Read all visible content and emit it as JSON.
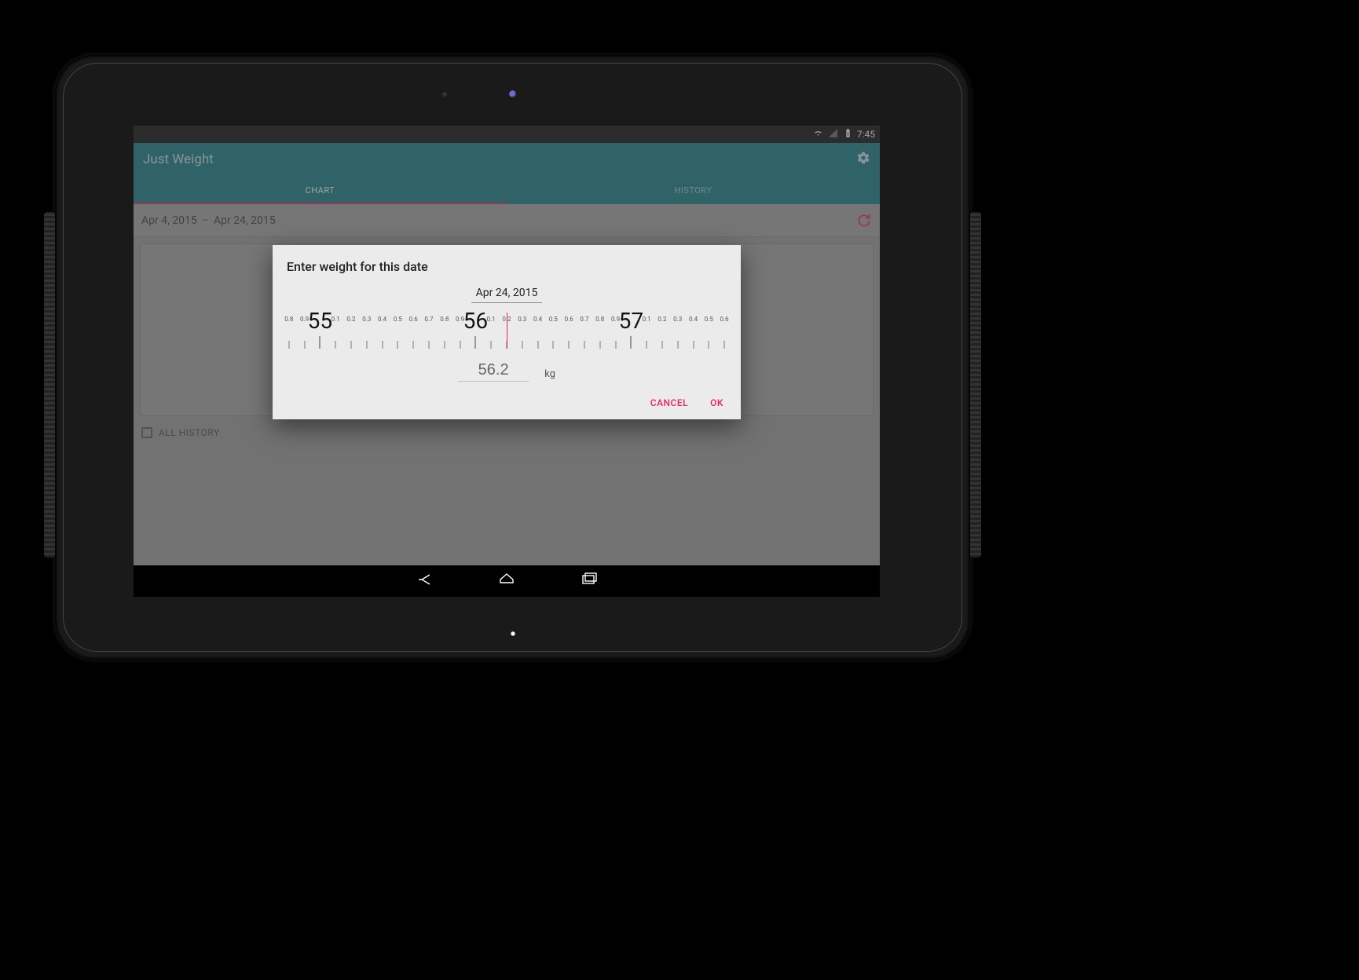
{
  "status_bar": {
    "time": "7:45"
  },
  "app": {
    "title": "Just Weight",
    "tabs": {
      "chart": "CHART",
      "history": "HISTORY",
      "active": "chart"
    }
  },
  "date_range": {
    "from": "Apr 4, 2015",
    "to": "Apr 24, 2015"
  },
  "all_history_label": "ALL HISTORY",
  "dialog": {
    "title": "Enter weight for this date",
    "date": "Apr 24, 2015",
    "value": "56.2",
    "unit": "kg",
    "cancel": "CANCEL",
    "ok": "OK",
    "ruler": {
      "start": 54.8,
      "end": 57.6,
      "step": 0.1,
      "center": 56.2,
      "majors": [
        55,
        56,
        57
      ]
    }
  },
  "colors": {
    "primary": "#0b7b86",
    "accent": "#e91e63"
  }
}
